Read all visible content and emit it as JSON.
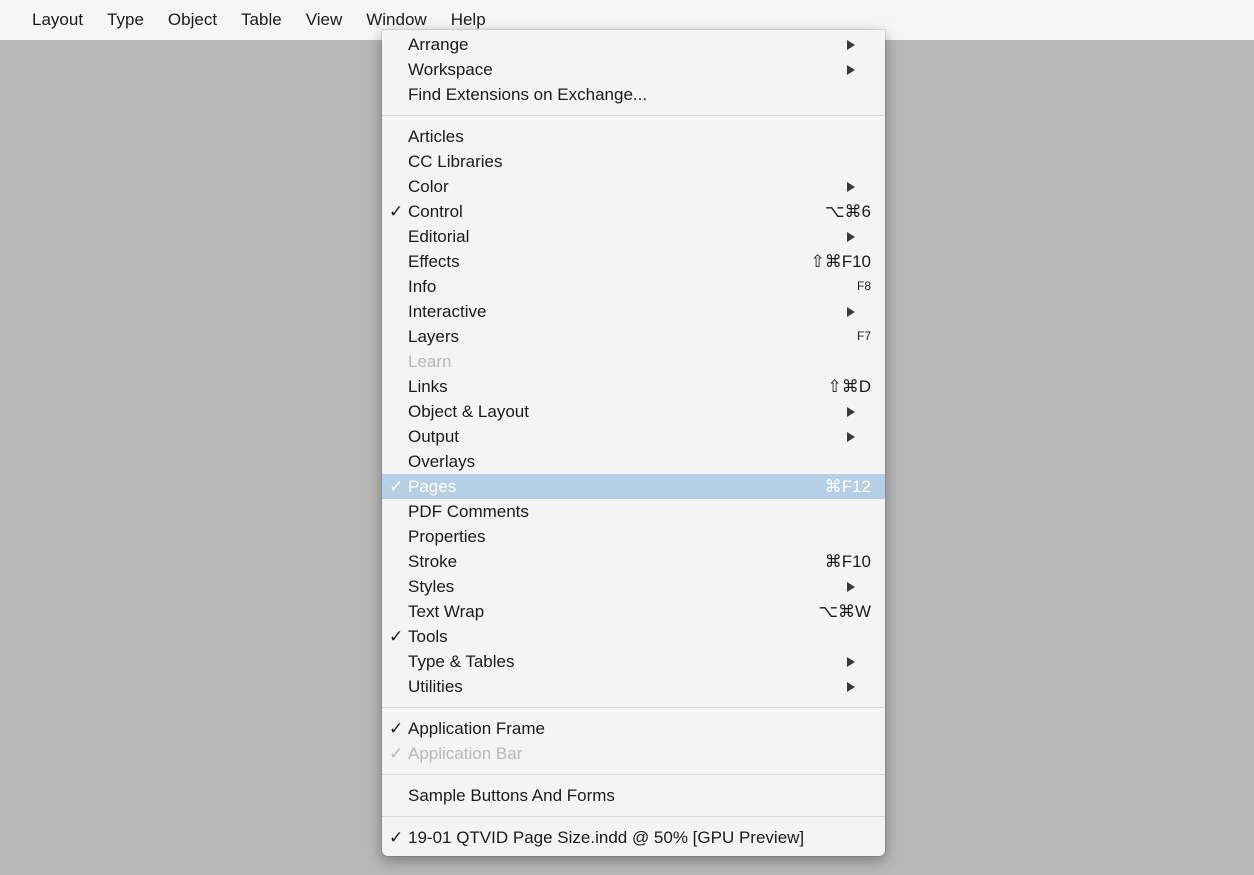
{
  "menubar": {
    "items": [
      "Layout",
      "Type",
      "Object",
      "Table",
      "View",
      "Window",
      "Help"
    ],
    "active": "Window"
  },
  "menu": {
    "group1": [
      {
        "label": "Arrange",
        "submenu": true
      },
      {
        "label": "Workspace",
        "submenu": true
      },
      {
        "label": "Find Extensions on Exchange..."
      }
    ],
    "group2": [
      {
        "label": "Articles"
      },
      {
        "label": "CC Libraries"
      },
      {
        "label": "Color",
        "submenu": true
      },
      {
        "label": "Control",
        "checked": true,
        "shortcut": "⌥⌘6"
      },
      {
        "label": "Editorial",
        "submenu": true
      },
      {
        "label": "Effects",
        "shortcut": "⇧⌘F10"
      },
      {
        "label": "Info",
        "shortcut": "F8"
      },
      {
        "label": "Interactive",
        "submenu": true
      },
      {
        "label": "Layers",
        "shortcut": "F7"
      },
      {
        "label": "Learn",
        "disabled": true
      },
      {
        "label": "Links",
        "shortcut": "⇧⌘D"
      },
      {
        "label": "Object & Layout",
        "submenu": true
      },
      {
        "label": "Output",
        "submenu": true
      },
      {
        "label": "Overlays"
      },
      {
        "label": "Pages",
        "checked": true,
        "highlighted": true,
        "shortcut": "⌘F12"
      },
      {
        "label": "PDF Comments"
      },
      {
        "label": "Properties"
      },
      {
        "label": "Stroke",
        "shortcut": "⌘F10"
      },
      {
        "label": "Styles",
        "submenu": true
      },
      {
        "label": "Text Wrap",
        "shortcut": "⌥⌘W"
      },
      {
        "label": "Tools",
        "checked": true
      },
      {
        "label": "Type & Tables",
        "submenu": true
      },
      {
        "label": "Utilities",
        "submenu": true
      }
    ],
    "group3": [
      {
        "label": "Application Frame",
        "checked": true
      },
      {
        "label": "Application Bar",
        "checked": true,
        "disabled": true
      }
    ],
    "group4": [
      {
        "label": "Sample Buttons And Forms"
      }
    ],
    "group5": [
      {
        "label": "19-01 QTVID Page Size.indd @ 50% [GPU Preview]",
        "checked": true
      }
    ]
  },
  "glyphs": {
    "check": "✓"
  },
  "colors": {
    "desktop": "#b7b7b7",
    "menu_bg": "#f4f4f4",
    "highlight": "#b6cee6",
    "disabled_text": "#b8b8b8"
  }
}
